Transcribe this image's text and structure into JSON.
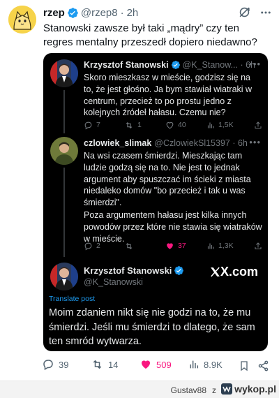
{
  "outer": {
    "name": "rzep",
    "handle": "@rzep8",
    "time": "2h",
    "text": "Stanowski zawsze był taki „mądry” czy ten regres mentalny przeszedł dopiero niedawno?",
    "actions": {
      "replies": "39",
      "reposts": "14",
      "likes": "509",
      "views": "8.9K"
    }
  },
  "card": {
    "tweet1": {
      "name": "Krzysztof Stanowski",
      "handle": "@K_Stanow...",
      "time": "6h",
      "text": "Skoro mieszkasz w mieście, godzisz się na to, że jest głośno. Ja bym stawiał wiatraki w centrum, przecież to po prostu jedno z kolejnych źródeł hałasu. Czemu nie?",
      "replies": "7",
      "reposts": "1",
      "likes": "40",
      "views": "1,5K"
    },
    "tweet2": {
      "name": "czlowiek_slimak",
      "handle": "@CzlowiekSl15397",
      "time": "6h",
      "text1": "Na wsi czasem śmierdzi. Mieszkając tam ludzie godzą się na to. Nie jest to jednak argument aby spuszczać im ścieki z miasta niedaleko domów \"bo przecież i tak u was śmierdzi\".",
      "text2": "Poza argumentem hałasu jest kilka innych powodów przez które nie stawia się wiatraków w mieście.",
      "replies": "2",
      "likes": "37",
      "views": "1,3K"
    },
    "tweet3": {
      "name": "Krzysztof Stanowski",
      "handle": "@K_Stanowski",
      "brand": "X.com",
      "translate": "Translate post",
      "text": "Moim zdaniem nikt się nie godzi na to, że mu śmierdzi. Jeśli mu śmierdzi to dlatego, że sam ten smród wytwarza."
    }
  },
  "footer": {
    "user": "Gustav88",
    "z": "z",
    "site": "wykop.pl"
  },
  "colors": {
    "like_pink": "#f91880",
    "verified_blue": "#1d9bf0",
    "card_bg": "#000000"
  }
}
